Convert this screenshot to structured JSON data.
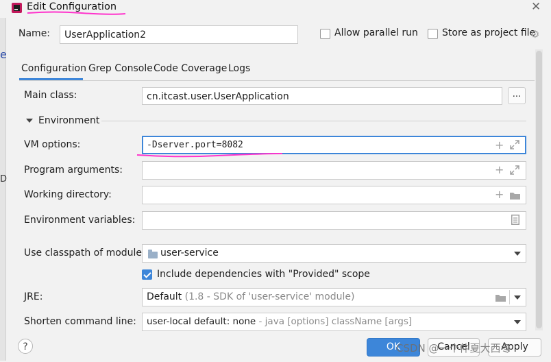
{
  "window": {
    "title": "Edit Configuration",
    "close_glyph": "✕"
  },
  "left_strip": {
    "chars": [
      "e",
      "D"
    ]
  },
  "header": {
    "name_label": "Name:",
    "name_value": "UserApplication2",
    "allow_parallel_label": "Allow parallel run",
    "allow_parallel_checked": false,
    "store_project_label": "Store as project file",
    "store_project_checked": false
  },
  "tabs": [
    {
      "label": "Configuration",
      "active": true
    },
    {
      "label": "Grep Console",
      "active": false
    },
    {
      "label": "Code Coverage",
      "active": false
    },
    {
      "label": "Logs",
      "active": false
    }
  ],
  "form": {
    "main_class_label": "Main class:",
    "main_class_value": "cn.itcast.user.UserApplication",
    "browse_button": "...",
    "environment_section": "Environment",
    "vm_options_label": "VM options:",
    "vm_options_value": "-Dserver.port=8082",
    "program_args_label": "Program arguments:",
    "program_args_value": "",
    "working_dir_label": "Working directory:",
    "working_dir_value": "",
    "env_vars_label": "Environment variables:",
    "env_vars_value": "",
    "classpath_label": "Use classpath of module:",
    "classpath_value": "user-service",
    "include_deps_label": "Include dependencies with \"Provided\" scope",
    "include_deps_checked": true,
    "jre_label": "JRE:",
    "jre_value": "Default",
    "jre_detail": "(1.8 - SDK of 'user-service' module)",
    "shorten_label": "Shorten command line:",
    "shorten_value": "user-local default: none",
    "shorten_detail": "- java [options] className [args]"
  },
  "footer": {
    "help": "?",
    "ok": "OK",
    "cancel": "Cancel",
    "apply": "Apply",
    "watermark": "CSDN @一个仲夏大西冬"
  },
  "colors": {
    "accent": "#3d86d9",
    "annotation": "#ff33cc"
  },
  "icons": [
    "app-icon",
    "close-icon",
    "plus-icon",
    "expand-icon",
    "folder-icon",
    "document-icon",
    "gear-icon",
    "chevron-down-icon",
    "module-folder-icon"
  ]
}
